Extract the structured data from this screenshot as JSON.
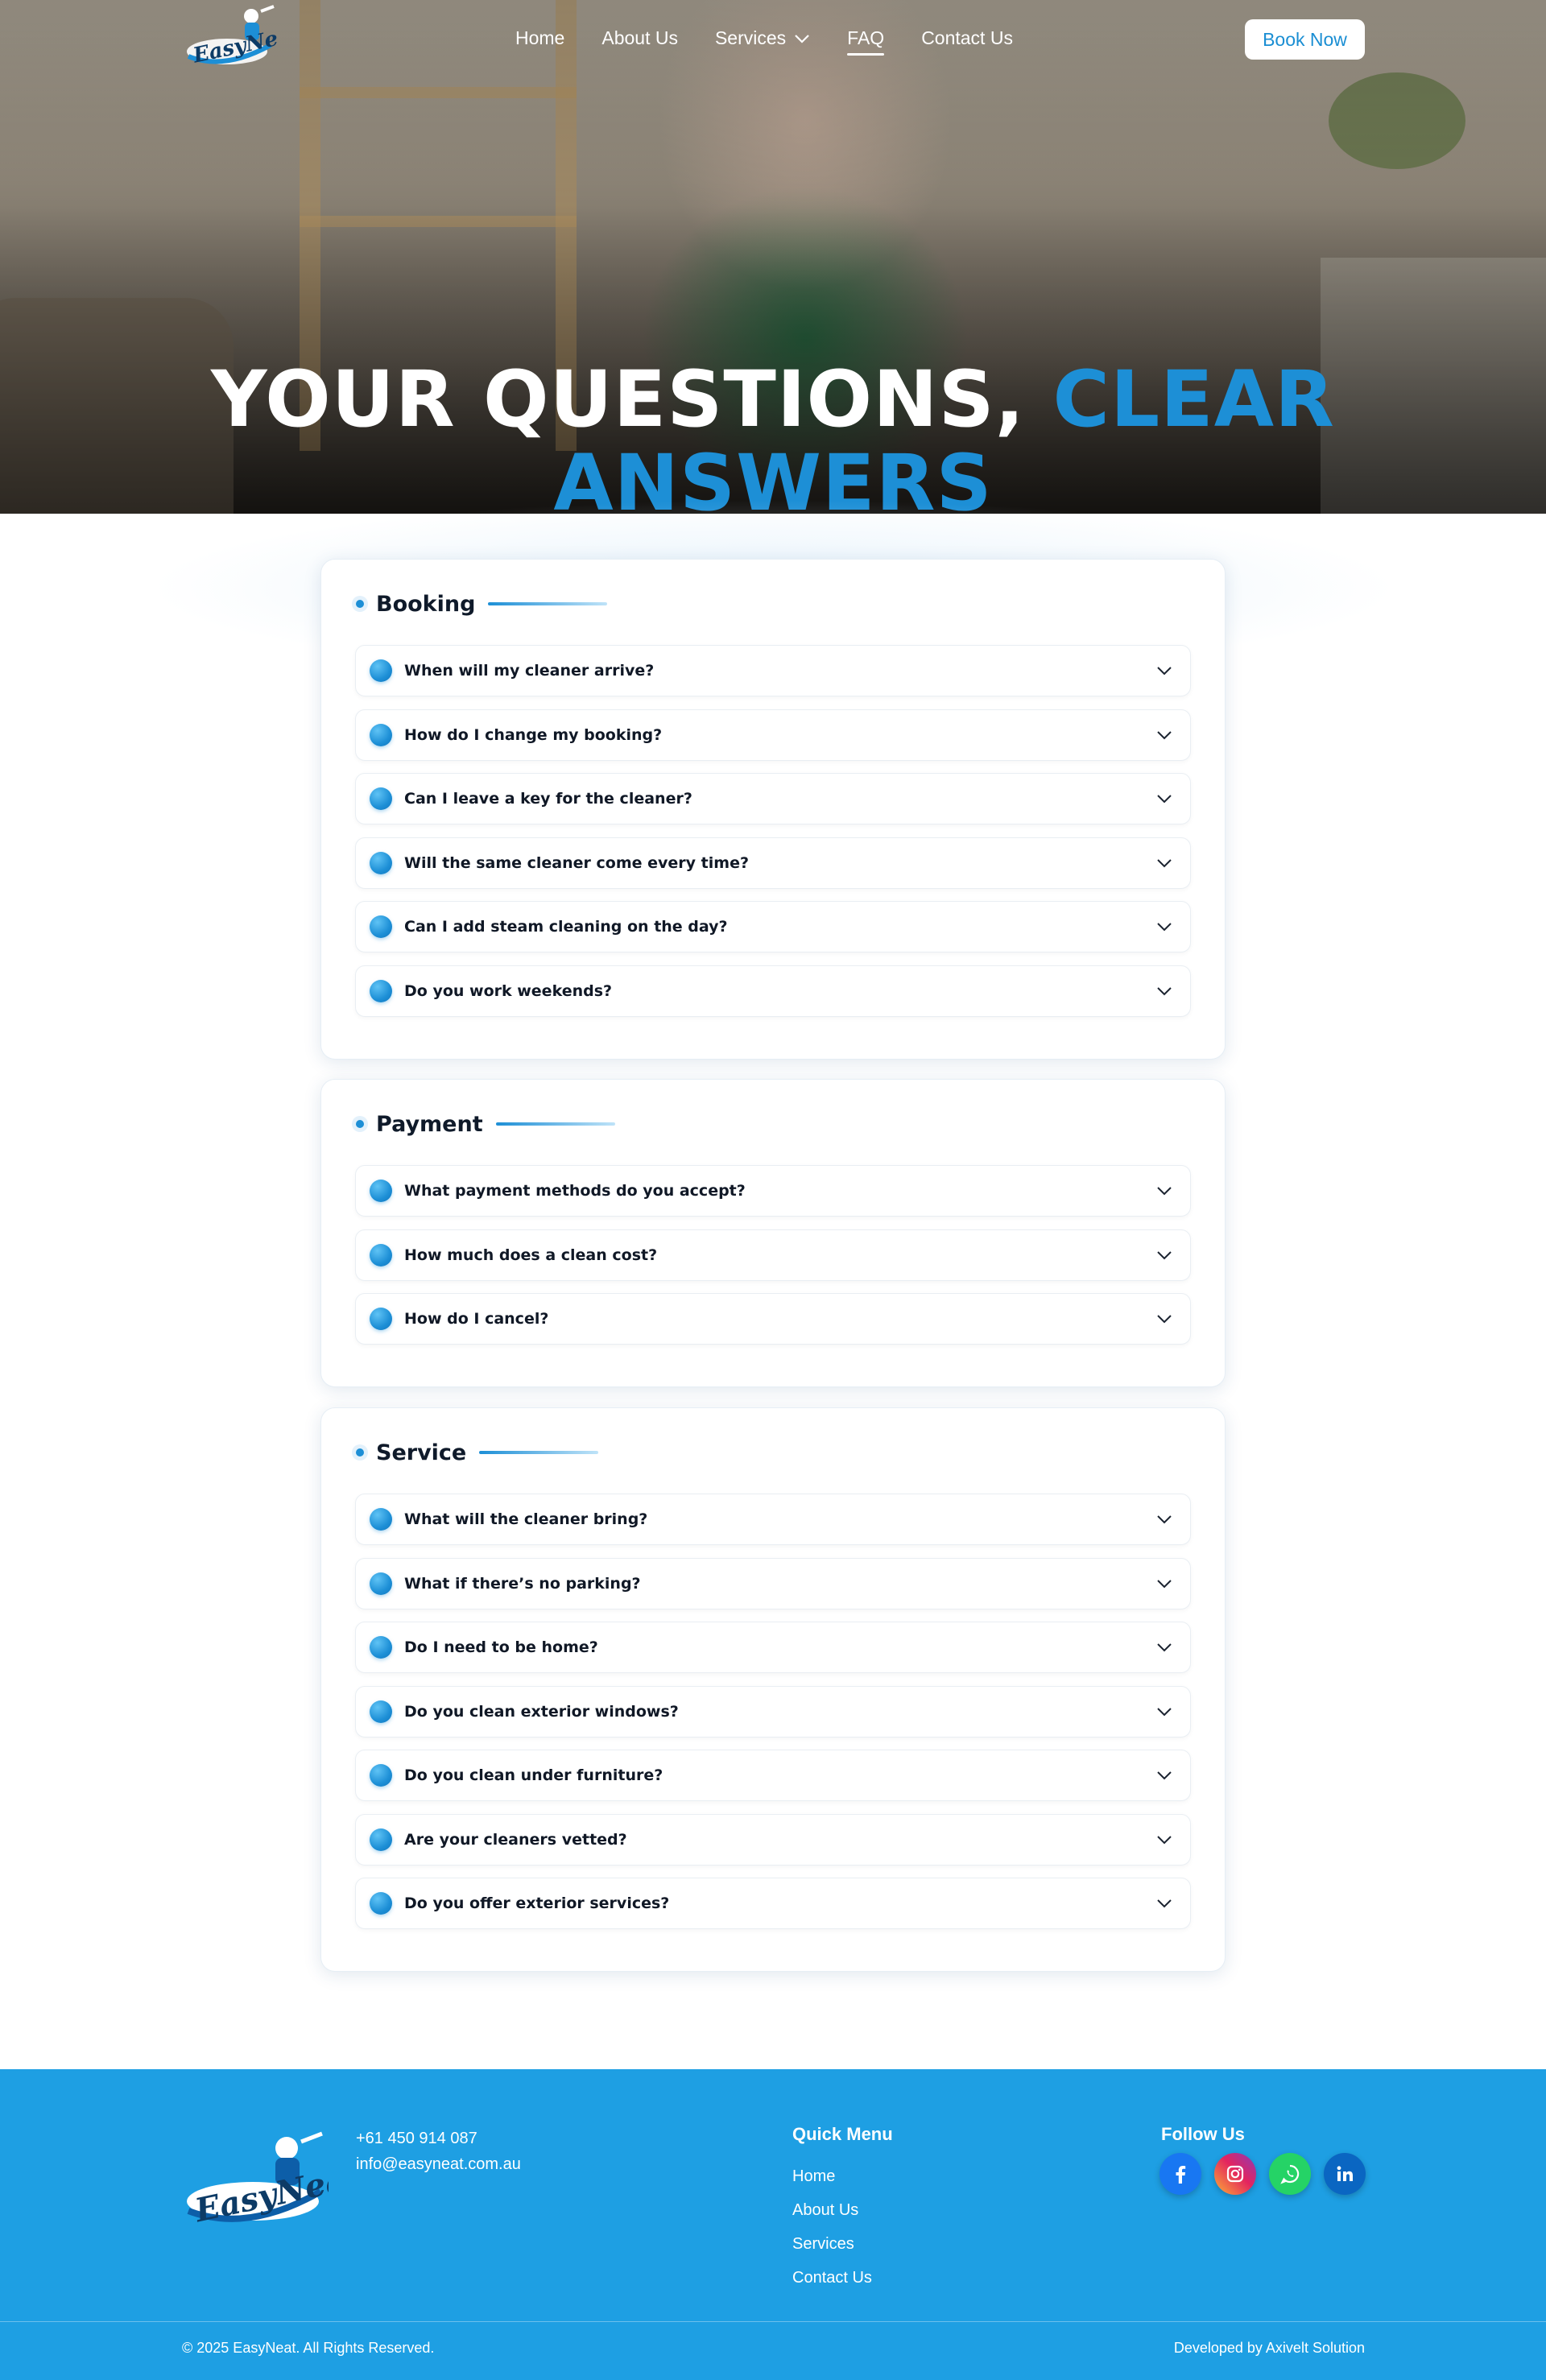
{
  "nav": {
    "logo_text": "EasyNeat",
    "links": [
      {
        "label": "Home"
      },
      {
        "label": "About Us"
      },
      {
        "label": "Services"
      },
      {
        "label": "FAQ"
      },
      {
        "label": "Contact Us"
      }
    ],
    "active": "FAQ",
    "book_label": "Book Now"
  },
  "hero": {
    "title_white": "YOUR QUESTIONS,",
    "title_blue_1": "CLEAR",
    "title_blue_2": "ANSWERS"
  },
  "sections": [
    {
      "title": "Booking",
      "questions": [
        "When will my cleaner arrive?",
        "How do I change my booking?",
        "Can I leave a key for the cleaner?",
        "Will the same cleaner come every time?",
        "Can I add steam cleaning on the day?",
        "Do you work weekends?"
      ]
    },
    {
      "title": "Payment",
      "questions": [
        "What payment methods do you accept?",
        "How much does a clean cost?",
        "How do I cancel?"
      ]
    },
    {
      "title": "Service",
      "questions": [
        "What will the cleaner bring?",
        "What if there’s no parking?",
        "Do I need to be home?",
        "Do you clean exterior windows?",
        "Do you clean under furniture?",
        "Are your cleaners vetted?",
        "Do you offer exterior services?"
      ]
    }
  ],
  "footer": {
    "logo_text": "EasyNeat",
    "phone": "+61 450 914 087",
    "email": "info@easyneat.com.au",
    "quick_menu_title": "Quick Menu",
    "quick_menu": [
      "Home",
      "About Us",
      "Services",
      "Contact Us"
    ],
    "follow_title": "Follow Us",
    "social": [
      {
        "icon": "facebook-icon",
        "color": "#1877f2"
      },
      {
        "icon": "instagram-icon",
        "color": "#d6249f"
      },
      {
        "icon": "whatsapp-icon",
        "color": "#25d366"
      },
      {
        "icon": "linkedin-icon",
        "color": "#0a66c2"
      }
    ],
    "copyright": "© 2025 EasyNeat. All Rights Reserved.",
    "developer": "Developed by Axivelt Solution"
  },
  "colors": {
    "accent": "#1d8fd6",
    "footer_bg": "#1e9fe3"
  }
}
